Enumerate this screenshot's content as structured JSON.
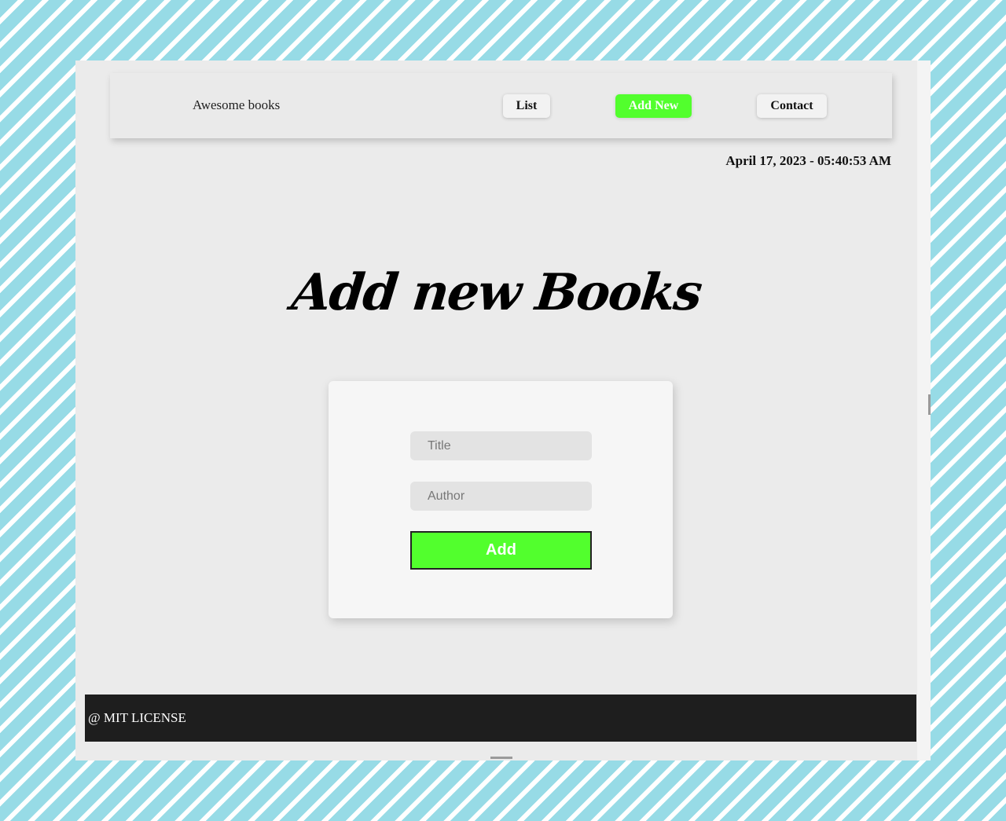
{
  "navbar": {
    "brand": "Awesome books",
    "links": {
      "list": "List",
      "add_new": "Add New",
      "contact": "Contact"
    },
    "active_link": "Add New"
  },
  "datetime": "April 17, 2023 - 05:40:53 AM",
  "main": {
    "heading": "Add new Books",
    "form": {
      "title_placeholder": "Title",
      "author_placeholder": "Author",
      "submit_label": "Add"
    }
  },
  "footer": {
    "text": "@ MIT LICENSE"
  },
  "colors": {
    "accent_green": "#52ff2d",
    "footer_bg": "#1e1e1e",
    "page_bg": "#ebebeb",
    "stripe_blue": "#97dbe6"
  }
}
